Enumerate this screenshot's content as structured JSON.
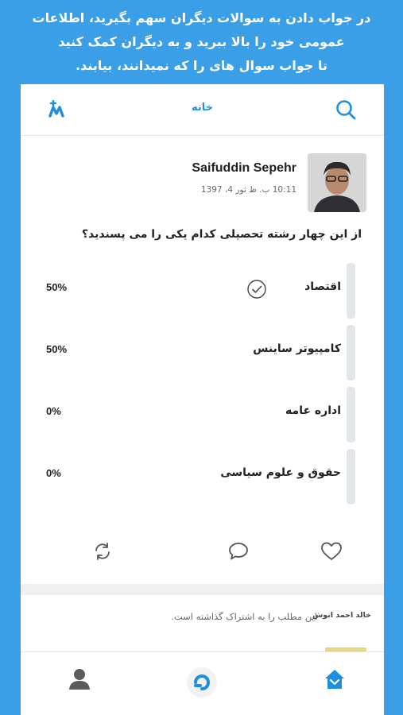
{
  "promo": {
    "line1": "در جواب دادن به سوالات دیگران سهم بگیرید، اطلاعات",
    "line2": "عمومی خود را بالا ببرید و به دیگران کمک کنید",
    "line3": "تا جواب سوال های را که نمیدانند، بیابند."
  },
  "header": {
    "title": "خانه",
    "logo_icon": "add-user-logo-icon",
    "search_icon": "search-icon"
  },
  "post": {
    "author": "Saifuddin Sepehr",
    "timestamp": "10:11 ب. ظ  ثور 4، 1397",
    "question": "از این چهار رشته تحصیلی کدام یکی را می پسندید؟",
    "options": [
      {
        "label": "اقتصاد",
        "percent": "50%",
        "selected": true
      },
      {
        "label": "کامپیوتر ساینس",
        "percent": "50%",
        "selected": false
      },
      {
        "label": "اداره عامه",
        "percent": "0%",
        "selected": false
      },
      {
        "label": "حقوق و علوم سیاسی",
        "percent": "0%",
        "selected": false
      }
    ],
    "actions": [
      "like-icon",
      "comment-icon",
      "repost-icon"
    ]
  },
  "activity": {
    "user": "خالد احمد انوش",
    "text": "این مطلب را به اشتراک گذاشته است."
  },
  "bottom_nav": [
    "home-icon",
    "compose-icon",
    "profile-icon"
  ],
  "colors": {
    "brand_blue": "#3a9fe6",
    "accent": "#1e8ee0",
    "bar_gray": "#e2e6ea"
  }
}
